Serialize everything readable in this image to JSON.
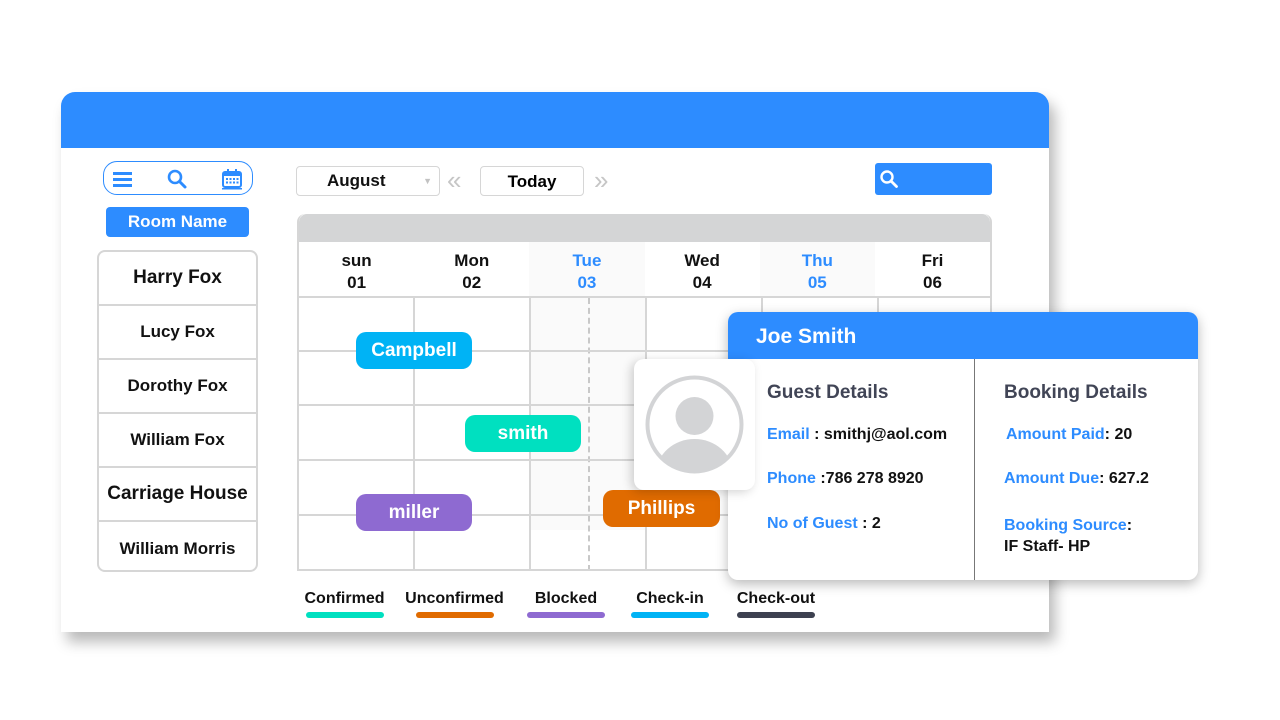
{
  "toolbar": {
    "icons": [
      "menu-icon",
      "search-icon",
      "calendar-icon"
    ],
    "room_name_button": "Room Name",
    "month_select": "August",
    "prev_label": "«",
    "today_label": "Today",
    "next_label": "»",
    "search_placeholder": ""
  },
  "rooms": [
    "Harry  Fox",
    "Lucy Fox",
    "Dorothy Fox",
    "William Fox",
    "Carriage House",
    "William Morris"
  ],
  "calendar": {
    "days": [
      {
        "name": "sun",
        "date": "01",
        "highlight": false
      },
      {
        "name": "Mon",
        "date": "02",
        "highlight": false
      },
      {
        "name": "Tue",
        "date": "03",
        "highlight": true
      },
      {
        "name": "Wed",
        "date": "04",
        "highlight": false
      },
      {
        "name": "Thu",
        "date": "05",
        "highlight": true
      },
      {
        "name": "Fri",
        "date": "06",
        "highlight": false
      }
    ],
    "bookings": [
      {
        "guest": "Campbell",
        "status": "Check-in"
      },
      {
        "guest": "smith",
        "status": "Confirmed"
      },
      {
        "guest": "miller",
        "status": "Blocked"
      },
      {
        "guest": "Phillips",
        "status": "Unconfirmed"
      }
    ]
  },
  "legend": [
    {
      "label": "Confirmed",
      "color": "#00e0c0"
    },
    {
      "label": "Unconfirmed",
      "color": "#e06b00"
    },
    {
      "label": "Blocked",
      "color": "#8e6ad1"
    },
    {
      "label": "Check-in",
      "color": "#00b3f5"
    },
    {
      "label": "Check-out",
      "color": "#3d4150"
    }
  ],
  "popup": {
    "guest_name": "Joe Smith",
    "guest_details_title": "Guest Details",
    "booking_details_title": "Booking Details",
    "email_label": "Email",
    "email_value": " : smithj@aol.com",
    "phone_label": "Phone",
    "phone_value": " :786 278 8920",
    "guests_label": "No of Guest",
    "guests_value": " : 2",
    "amount_paid_label": "Amount Paid",
    "amount_paid_value": ": 20",
    "amount_due_label": "Amount Due",
    "amount_due_value": ": 627.2",
    "booking_source_label": "Booking Source",
    "booking_source_sep": ":",
    "booking_source_value": "IF Staff- HP"
  },
  "colors": {
    "accent": "#2d8cff",
    "checkin": "#00b3f5",
    "confirmed": "#00e0c0",
    "blocked": "#8e6ad1",
    "unconfirmed": "#e06b00"
  }
}
